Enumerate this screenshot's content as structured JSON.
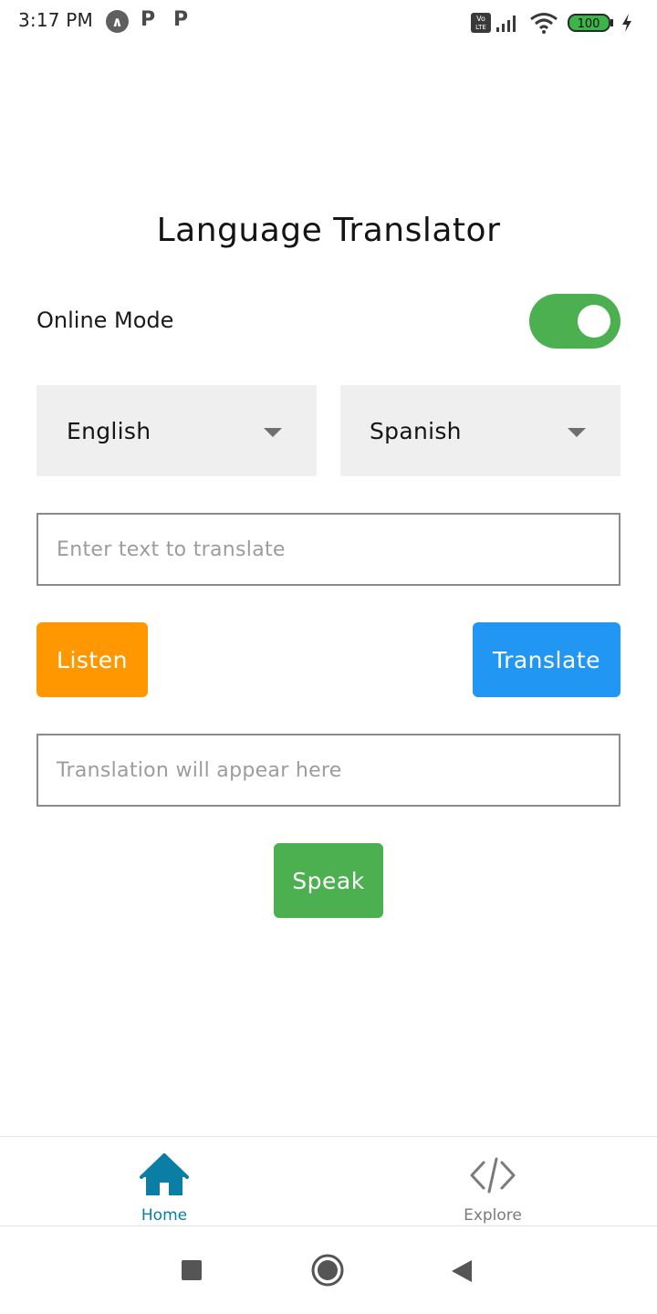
{
  "status_bar": {
    "time": "3:17 PM",
    "notification_icons": [
      "accessibility-icon",
      "p-icon",
      "p-icon"
    ],
    "battery": "100",
    "volte": "Vo LTE"
  },
  "app": {
    "title": "Language Translator",
    "online_mode_label": "Online Mode",
    "online_mode_enabled": true,
    "source_language": "English",
    "target_language": "Spanish",
    "input_placeholder": "Enter text to translate",
    "output_placeholder": "Translation will appear here",
    "listen_label": "Listen",
    "translate_label": "Translate",
    "speak_label": "Speak",
    "colors": {
      "toggle_on": "#4caf50",
      "listen": "#ff9800",
      "translate": "#2196f3",
      "speak": "#4caf50",
      "active_tab": "#0a7ea4"
    }
  },
  "tabs": [
    {
      "label": "Home",
      "icon": "home-icon",
      "active": true
    },
    {
      "label": "Explore",
      "icon": "code-icon",
      "active": false
    }
  ]
}
